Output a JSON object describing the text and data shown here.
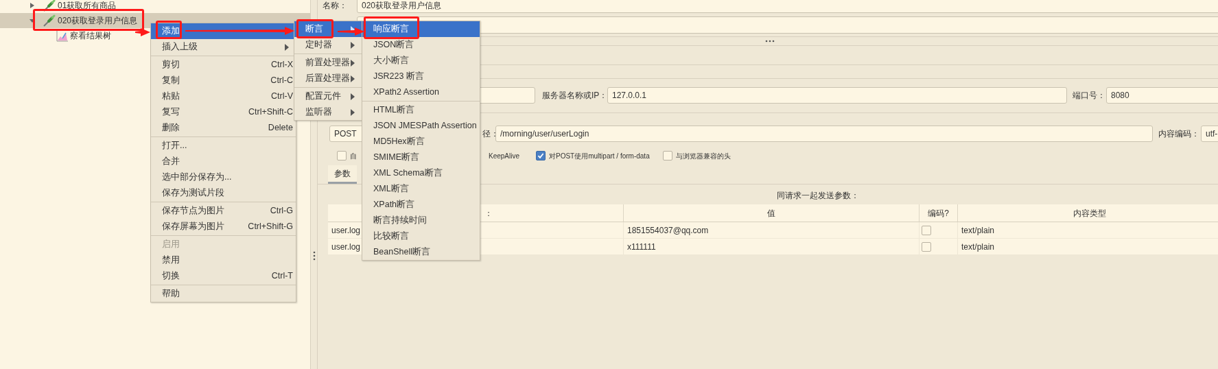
{
  "tree": [
    {
      "label": "01获取所有商品",
      "kind": "sampler",
      "expanded": false,
      "selected": false
    },
    {
      "label": "020获取登录用户信息",
      "kind": "sampler",
      "expanded": true,
      "selected": true,
      "children": [
        {
          "label": "察看结果树",
          "kind": "listener",
          "selected": false
        }
      ]
    }
  ],
  "context_menu": {
    "groups": [
      [
        {
          "label": "添加",
          "selected": true,
          "disabled": false
        },
        {
          "label": "插入上级",
          "submenu": true,
          "selected": false,
          "disabled": false
        }
      ],
      [
        {
          "label": "剪切",
          "shortcut": "Ctrl-X",
          "submenu": false,
          "selected": false,
          "disabled": false
        },
        {
          "label": "复制",
          "shortcut": "Ctrl-C",
          "submenu": false,
          "selected": false,
          "disabled": false
        },
        {
          "label": "粘贴",
          "shortcut": "Ctrl-V",
          "submenu": false,
          "selected": false,
          "disabled": false
        },
        {
          "label": "复写",
          "shortcut": "Ctrl+Shift-C",
          "submenu": false,
          "selected": false,
          "disabled": false
        },
        {
          "label": "删除",
          "shortcut": "Delete",
          "submenu": false,
          "selected": false,
          "disabled": false
        }
      ],
      [
        {
          "label": "打开...",
          "submenu": false,
          "selected": false,
          "disabled": false
        },
        {
          "label": "合并",
          "submenu": false,
          "selected": false,
          "disabled": false
        },
        {
          "label": "选中部分保存为...",
          "submenu": false,
          "selected": false,
          "disabled": false
        },
        {
          "label": "保存为测试片段",
          "submenu": false,
          "selected": false,
          "disabled": false
        }
      ],
      [
        {
          "label": "保存节点为图片",
          "shortcut": "Ctrl-G",
          "submenu": false,
          "selected": false,
          "disabled": false
        },
        {
          "label": "保存屏幕为图片",
          "shortcut": "Ctrl+Shift-G",
          "submenu": false,
          "selected": false,
          "disabled": false
        }
      ],
      [
        {
          "label": "启用",
          "submenu": false,
          "selected": false,
          "disabled": true
        },
        {
          "label": "禁用",
          "submenu": false,
          "selected": false,
          "disabled": false
        },
        {
          "label": "切换",
          "shortcut": "Ctrl-T",
          "submenu": false,
          "selected": false,
          "disabled": false
        }
      ],
      [
        {
          "label": "帮助",
          "submenu": false,
          "selected": false,
          "disabled": false
        }
      ]
    ]
  },
  "add_submenu": {
    "groups": [
      [
        {
          "label": "断言",
          "submenu": true,
          "selected": true
        },
        {
          "label": "定时器",
          "submenu": true,
          "selected": false
        }
      ],
      [
        {
          "label": "前置处理器",
          "submenu": true,
          "selected": false
        },
        {
          "label": "后置处理器",
          "submenu": true,
          "selected": false
        }
      ],
      [
        {
          "label": "配置元件",
          "submenu": true,
          "selected": false
        },
        {
          "label": "监听器",
          "submenu": true,
          "selected": false
        }
      ]
    ]
  },
  "assertion_submenu": {
    "groups": [
      [
        {
          "label": "响应断言",
          "selected": true
        },
        {
          "label": "JSON断言",
          "selected": false
        },
        {
          "label": "大小断言",
          "selected": false
        },
        {
          "label": "JSR223 断言",
          "selected": false
        },
        {
          "label": "XPath2 Assertion",
          "selected": false
        }
      ],
      [
        {
          "label": "HTML断言",
          "selected": false
        },
        {
          "label": "JSON JMESPath Assertion",
          "selected": false
        },
        {
          "label": "MD5Hex断言",
          "selected": false
        },
        {
          "label": "SMIME断言",
          "selected": false
        },
        {
          "label": "XML Schema断言",
          "selected": false
        },
        {
          "label": "XML断言",
          "selected": false
        },
        {
          "label": "XPath断言",
          "selected": false
        },
        {
          "label": "断言持续时间",
          "selected": false
        },
        {
          "label": "比较断言",
          "selected": false
        },
        {
          "label": "BeanShell断言",
          "selected": false
        }
      ]
    ]
  },
  "name_field": {
    "label": "名称：",
    "value": "020获取登录用户信息"
  },
  "server": {
    "server_label": "服务器名称或IP：",
    "server_value": "127.0.0.1",
    "port_label": "端口号：",
    "port_value": "8080"
  },
  "request": {
    "method": "POST",
    "path_label": "径：",
    "path_value": "/morning/user/userLogin",
    "encoding_label": "内容编码：",
    "encoding_value": "utf-"
  },
  "options": [
    {
      "kind": "checkbox",
      "label": "自",
      "checked": false
    },
    {
      "kind": "text",
      "label": "KeepAlive"
    },
    {
      "kind": "checkbox",
      "label": "对POST使用multipart / form-data",
      "checked": true
    },
    {
      "kind": "checkbox",
      "label": "与浏览器兼容的头",
      "checked": false
    }
  ],
  "tabs": [
    {
      "label": "参数",
      "selected": true
    }
  ],
  "table": {
    "title": "同请求一起发送参数：",
    "columns": [
      "：",
      "值",
      "编码?",
      "内容类型"
    ],
    "rows": [
      {
        "name": "user.log",
        "value": "1851554037@qq.com",
        "encode": false,
        "content_type": "text/plain"
      },
      {
        "name": "user.log",
        "value": "x111111",
        "encode": false,
        "content_type": "text/plain"
      }
    ]
  }
}
